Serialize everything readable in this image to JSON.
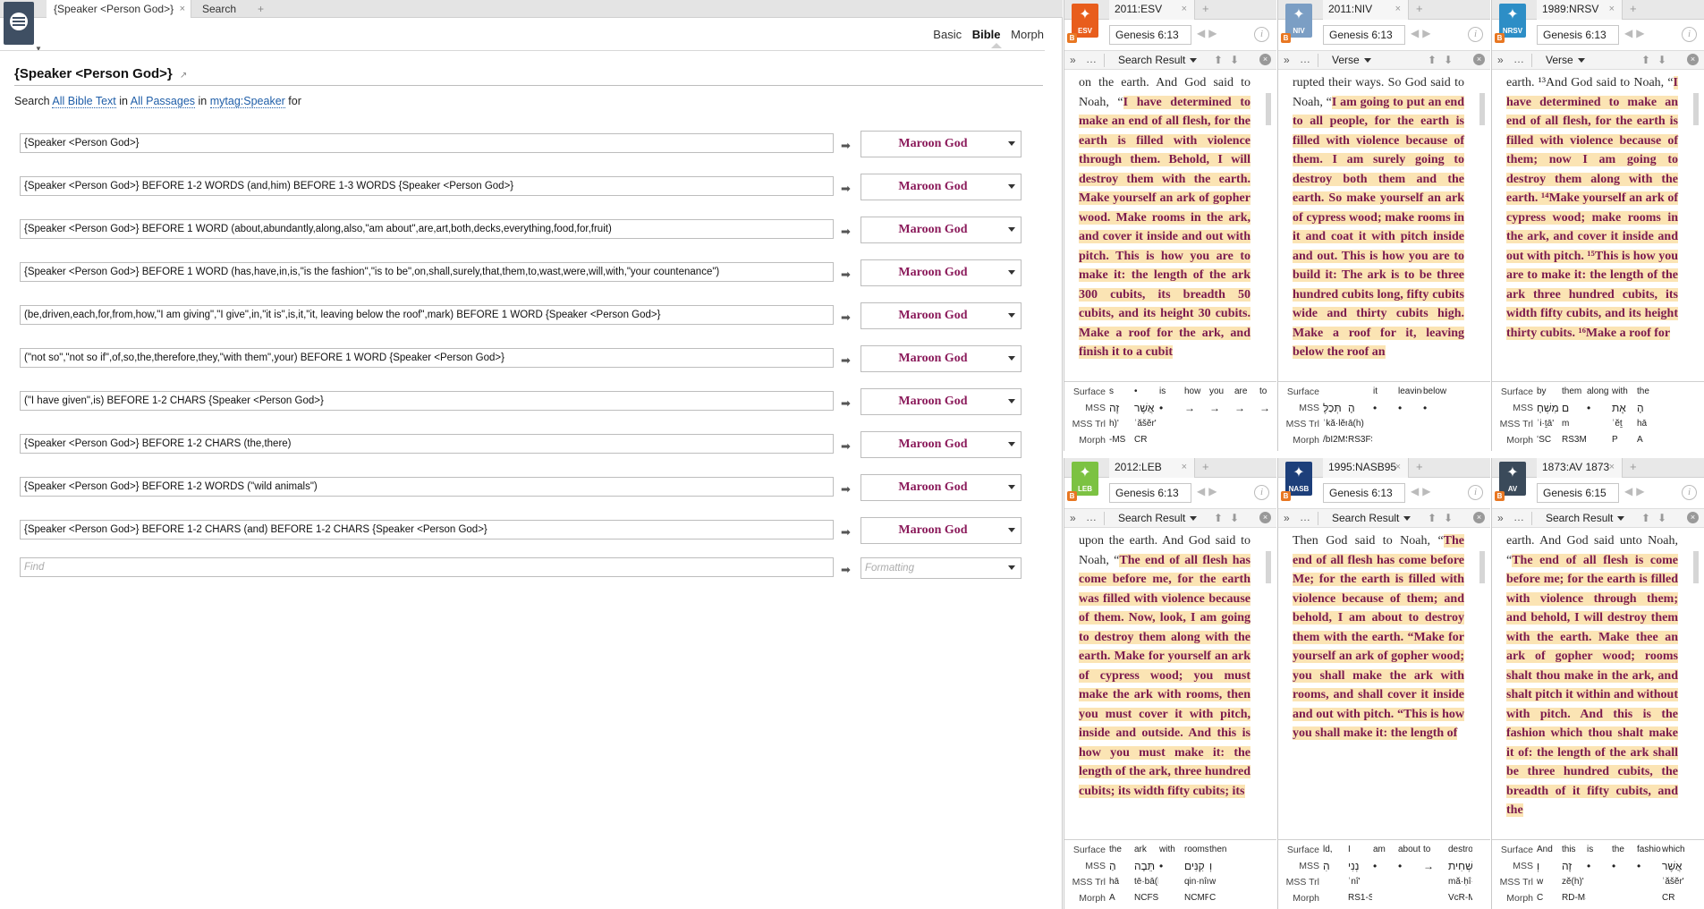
{
  "left": {
    "tabs": [
      {
        "label": "{Speaker <Person God>}"
      },
      {
        "label": "Search"
      }
    ],
    "tab_close": "×",
    "tab_add": "+",
    "modes": [
      "Basic",
      "Bible",
      "Morph"
    ],
    "active_mode": "Bible",
    "query_title": "{Speaker <Person God>}",
    "query_title_link": "↗",
    "search_line": {
      "prefix": "Search",
      "scope": "All Bible Text",
      "in": "in",
      "passages": "All Passages",
      "in2": "in",
      "tag": "mytag:Speaker",
      "suffix": "for"
    },
    "rows": [
      {
        "query": "{Speaker <Person God>}",
        "format": "Maroon God"
      },
      {
        "query": "{Speaker <Person God>} BEFORE 1-2 WORDS (and,him) BEFORE 1-3 WORDS {Speaker <Person God>}",
        "format": "Maroon God"
      },
      {
        "query": "{Speaker <Person God>} BEFORE 1 WORD (about,abundantly,along,also,\"am about\",are,art,both,decks,everything,food,for,fruit)",
        "format": "Maroon God"
      },
      {
        "query": "{Speaker <Person God>} BEFORE 1 WORD (has,have,in,is,\"is the fashion\",\"is to be\",on,shall,surely,that,them,to,wast,were,will,with,\"your countenance\")",
        "format": "Maroon God"
      },
      {
        "query": "(be,driven,each,for,from,how,\"I am giving\",\"I give\",in,\"it is\",is,it,\"it, leaving below the roof\",mark) BEFORE 1 WORD {Speaker <Person God>}",
        "format": "Maroon God"
      },
      {
        "query": "(\"not so\",\"not so if\",of,so,the,therefore,they,\"with them\",your) BEFORE 1 WORD {Speaker <Person God>}",
        "format": "Maroon God"
      },
      {
        "query": "(\"I have given\",is) BEFORE 1-2 CHARS {Speaker <Person God>}",
        "format": "Maroon God"
      },
      {
        "query": "{Speaker <Person God>} BEFORE 1-2 CHARS (the,there)",
        "format": "Maroon God"
      },
      {
        "query": "{Speaker <Person God>} BEFORE 1-2 WORDS (\"wild animals\")",
        "format": "Maroon God"
      },
      {
        "query": "{Speaker <Person God>} BEFORE 1-2 CHARS (and) BEFORE 1-2 CHARS {Speaker <Person God>}",
        "format": "Maroon God"
      }
    ],
    "find_placeholder": "Find",
    "formatting_placeholder": "Formatting"
  },
  "panels": [
    {
      "version": "2011:ESV",
      "badge": "ESV",
      "badge_color": "#e85d1c",
      "ref": "Genesis 6:13",
      "toolbar": "Search Result",
      "text_plain": "on the earth. And God said to Noah, “",
      "text_hl": "I have determined to make an end of all flesh, for the earth is filled with violence through them. Behold, I will destroy them with the earth. Make yourself an ark of gopher wood. Make rooms in the ark, and cover it inside and out with pitch. This is how you are to make it: the length of the ark 300 cubits, its breadth 50 cubits, and its height 30 cubits. Make a roof for the ark, and finish it to a cubit",
      "il": {
        "surface": [
          "s",
          "•",
          "is",
          "how",
          "you",
          "are",
          "to"
        ],
        "mss": [
          "זֶה",
          "אֲשֶׁר",
          "•",
          "→",
          "→",
          "→",
          "→"
        ],
        "trl": [
          "h)'",
          "ʾăšĕr'",
          "",
          "",
          "",
          "",
          ""
        ],
        "morph": [
          "-MS",
          "CR",
          "",
          "",
          "",
          "",
          ""
        ]
      }
    },
    {
      "version": "2011:NIV",
      "badge": "NIV",
      "badge_color": "#7b9ec4",
      "ref": "Genesis 6:13",
      "toolbar": "Verse",
      "text_plain": "rupted their ways. So God said to Noah, “",
      "text_hl": "I am going to put an end to all people, for the earth is filled with violence because of them. I am surely going to destroy both them and the earth. So make yourself an ark of cypress wood; make rooms in it and coat it with pitch inside and out. This is how you are to build it: The ark is to be three hundred cubits long, fifty cubits wide and thirty cubits high. Make a roof for it, leaving below the roof an",
      "il": {
        "surface": [
          "",
          "",
          "it",
          "leaving",
          "below",
          ""
        ],
        "mss": [
          "תְּכַלֶּ",
          "הָ",
          "•",
          "•",
          "•",
          ""
        ],
        "trl": [
          "ʾkă·lĕn'",
          "ā(h)",
          "",
          "",
          "",
          ""
        ],
        "morph": [
          "/bI2MS–E",
          "RS3FS",
          "",
          "",
          "",
          ""
        ]
      }
    },
    {
      "version": "1989:NRSV",
      "badge": "NRSV",
      "badge_color": "#2d8ec6",
      "ref": "Genesis 6:13",
      "toolbar": "Verse",
      "text_plain": "earth. ¹³And God said to Noah, “",
      "text_hl": "I have determined to make an end of all flesh, for the earth is filled with violence because of them; now I am going to destroy them along with the earth. ¹⁴Make yourself an ark of cypress wood; make rooms in the ark, and cover it inside and out with pitch. ¹⁵This is how you are to make it: the length of the ark three hundred cubits, its width fifty cubits, and its height thirty cubits. ¹⁶Make a roof for",
      "il": {
        "surface": [
          "by",
          "them",
          "along",
          "with",
          "the"
        ],
        "mss": [
          "מִשְׁחָ",
          "ם",
          "•",
          "אֶת",
          "הָ"
        ],
        "trl": [
          "ʾi·ṯā'",
          "m",
          "",
          "ʾĕṯ",
          "hā"
        ],
        "morph": [
          "ʻSC",
          "RS3MP",
          "",
          "P",
          "A"
        ]
      }
    },
    {
      "version": "2012:LEB",
      "badge": "LEB",
      "badge_color": "#7cc242",
      "ref": "Genesis 6:13",
      "toolbar": "Search Result",
      "text_plain": "upon the earth. And God said to Noah, “",
      "text_hl": "The end of all flesh has come before me, for the earth was filled with violence because of them. Now, look, I am going to destroy them along with the earth. Make for yourself an ark of cypress wood; you must make the ark with rooms, then you must cover it with pitch, inside and outside. And this is how you must make it: the length of the ark, three hundred cubits; its width fifty cubits; its",
      "il": {
        "surface": [
          "the",
          "ark",
          "with",
          "rooms,",
          "then"
        ],
        "mss": [
          "הַ",
          "תֵּבָה",
          "•",
          "קִנִּים",
          "וְ"
        ],
        "trl": [
          "hā",
          "tē·bā(h)'",
          "",
          "qin·nîm'",
          "w"
        ],
        "morph": [
          "A",
          "NCFSA",
          "",
          "NCMPA",
          "C"
        ]
      }
    },
    {
      "version": "1995:NASB95",
      "badge": "NASB",
      "badge_color": "#1d3f7a",
      "ref": "Genesis 6:13",
      "toolbar": "Search Result",
      "text_plain": "Then God said to Noah, “",
      "text_hl": "The end of all flesh has come before Me; for the earth is filled with violence because of them; and behold, I am about to destroy them with the earth. “Make for yourself an ark of gopher wood; you shall make the ark with rooms, and shall cover it inside and out with pitch. “This is how you shall make it: the length of",
      "il": {
        "surface": [
          "ld,",
          "I",
          "am",
          "about",
          "to",
          "destroy"
        ],
        "mss": [
          "הִ",
          "נְנִי",
          "•",
          "•",
          "→",
          "מַשְׁחִית"
        ],
        "trl": [
          "",
          "ʾnî'",
          "",
          "",
          "",
          "mă·ḥî·ṯā'"
        ],
        "morph": [
          "",
          "RS1-S",
          "",
          "",
          "",
          "VcR-MSC"
        ]
      }
    },
    {
      "version": "1873:AV 1873",
      "badge": "AV",
      "badge_color": "#3a4a5a",
      "ref": "Genesis 6:15",
      "toolbar": "Search Result",
      "text_plain": "earth. And God said unto Noah, “",
      "text_hl": "The end of all flesh is come before me; for the earth is filled with violence through them; and behold, I will destroy them with the earth. Make thee an ark of gopher wood; rooms shalt thou make in the ark, and shalt pitch it within and without with pitch. And this is the fashion which thou shalt make it of: the length of the ark shall be three hundred cubits, the breadth of it fifty cubits, and the",
      "il": {
        "surface": [
          "And",
          "this",
          "is",
          "the",
          "fashion",
          "which"
        ],
        "mss": [
          "וְ",
          "זֶה",
          "•",
          "•",
          "•",
          "אֲשֶׁר"
        ],
        "trl": [
          "w",
          "zĕ(h)'",
          "",
          "",
          "",
          "ʾăšĕr'"
        ],
        "morph": [
          "C",
          "RD-MS",
          "",
          "",
          "",
          "CR"
        ]
      }
    }
  ],
  "interlinear_labels": {
    "surface": "Surface",
    "mss": "MSS",
    "trl": "MSS Trl",
    "morph": "Morph"
  },
  "panel_toolbar": {
    "expand": "»",
    "more": "…",
    "close": "×",
    "tab_add": "+",
    "info": "i",
    "badge_b": "B"
  }
}
